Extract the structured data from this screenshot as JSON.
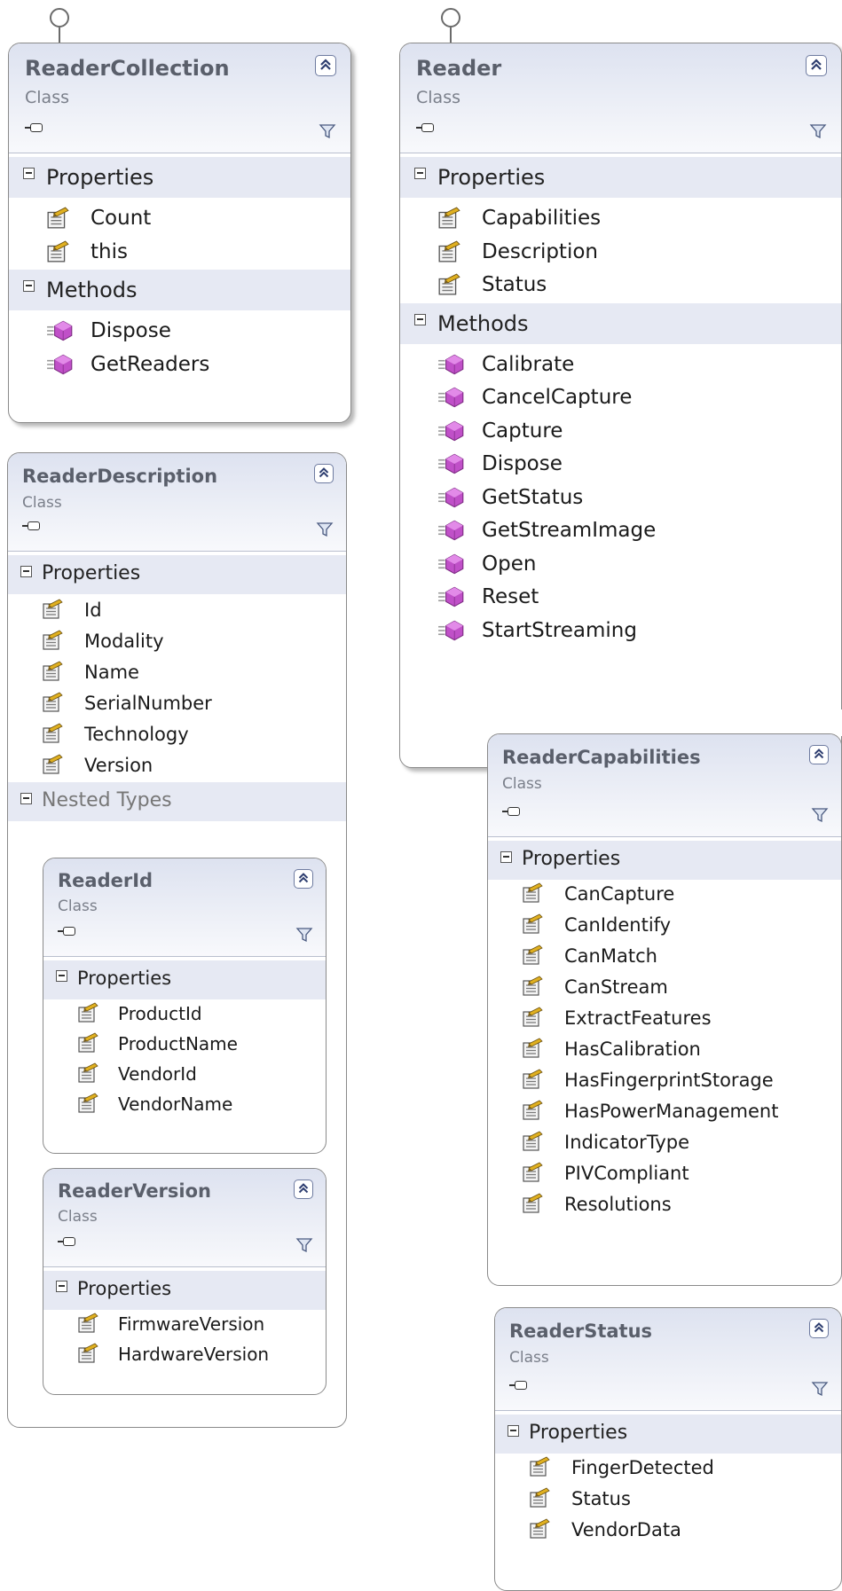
{
  "diagram": {
    "classes": {
      "reader_collection": {
        "name": "ReaderCollection",
        "kind": "Class",
        "sections": [
          {
            "title": "Properties",
            "members": [
              "Count",
              "this"
            ]
          },
          {
            "title": "Methods",
            "members": [
              "Dispose",
              "GetReaders"
            ]
          }
        ]
      },
      "reader": {
        "name": "Reader",
        "kind": "Class",
        "sections": [
          {
            "title": "Properties",
            "members": [
              "Capabilities",
              "Description",
              "Status"
            ]
          },
          {
            "title": "Methods",
            "members": [
              "Calibrate",
              "CancelCapture",
              "Capture",
              "Dispose",
              "GetStatus",
              "GetStreamImage",
              "Open",
              "Reset",
              "StartStreaming"
            ]
          }
        ]
      },
      "reader_description": {
        "name": "ReaderDescription",
        "kind": "Class",
        "sections": [
          {
            "title": "Properties",
            "members": [
              "Id",
              "Modality",
              "Name",
              "SerialNumber",
              "Technology",
              "Version"
            ]
          },
          {
            "title": "Nested Types",
            "members": []
          }
        ]
      },
      "reader_id": {
        "name": "ReaderId",
        "kind": "Class",
        "sections": [
          {
            "title": "Properties",
            "members": [
              "ProductId",
              "ProductName",
              "VendorId",
              "VendorName"
            ]
          }
        ]
      },
      "reader_version": {
        "name": "ReaderVersion",
        "kind": "Class",
        "sections": [
          {
            "title": "Properties",
            "members": [
              "FirmwareVersion",
              "HardwareVersion"
            ]
          }
        ]
      },
      "reader_capabilities": {
        "name": "ReaderCapabilities",
        "kind": "Class",
        "sections": [
          {
            "title": "Properties",
            "members": [
              "CanCapture",
              "CanIdentify",
              "CanMatch",
              "CanStream",
              "ExtractFeatures",
              "HasCalibration",
              "HasFingerprintStorage",
              "HasPowerManagement",
              "IndicatorType",
              "PIVCompliant",
              "Resolutions"
            ]
          }
        ]
      },
      "reader_status": {
        "name": "ReaderStatus",
        "kind": "Class",
        "sections": [
          {
            "title": "Properties",
            "members": [
              "FingerDetected",
              "Status",
              "VendorData"
            ]
          }
        ]
      }
    },
    "icons": {
      "property": "property-icon",
      "method": "method-icon",
      "collapse": "double-chevron-up-icon",
      "filter": "filter-icon",
      "interface": "plug-icon",
      "section": "minus-box-icon",
      "lollipop": "interface-lollipop-icon"
    },
    "colors": {
      "header_gradient": "#dde2f0",
      "section_band": "#e6e9f3",
      "border": "#8a8a8a",
      "method_icon": "#c050c8",
      "property_icon": "#e0b020"
    }
  }
}
